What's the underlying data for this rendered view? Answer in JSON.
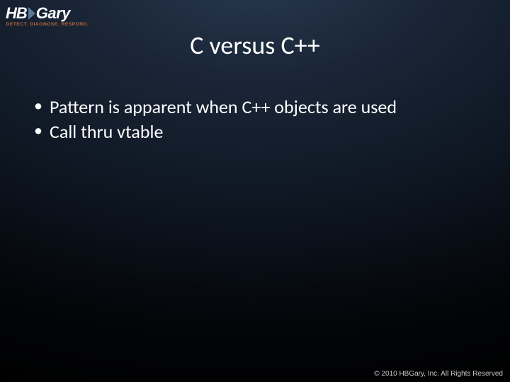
{
  "logo": {
    "prefix": "HB",
    "suffix": "Gary",
    "tagline": "DETECT. DIAGNOSE. RESPOND."
  },
  "title": "C versus C++",
  "bullets": [
    "Pattern is apparent when C++ objects are used",
    "Call thru vtable"
  ],
  "footer": "© 2010 HBGary, Inc. All Rights Reserved"
}
